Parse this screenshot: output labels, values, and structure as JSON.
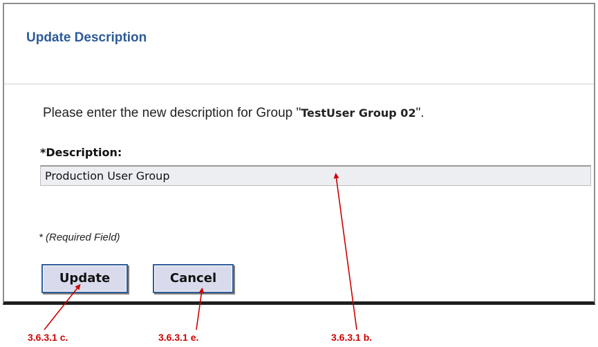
{
  "dialog": {
    "title": "Update Description",
    "prompt": {
      "prefix": "Please enter the new description for Group \"",
      "group_name": "TestUser Group 02",
      "suffix": "\"."
    },
    "description_label": "*Description:",
    "description_value": "Production User Group",
    "required_note": "* (Required Field)",
    "buttons": {
      "update": "Update",
      "cancel": "Cancel"
    }
  },
  "annotations": {
    "update_callout": "3.6.3.1 c.",
    "cancel_callout": "3.6.3.1 e.",
    "description_callout": "3.6.3.1 b.",
    "color": "#cc0000"
  },
  "colors": {
    "title": "#2c5a97",
    "button_fill": "#d9dbed",
    "button_border": "#2f5d9a",
    "input_fill": "#eceef2"
  }
}
